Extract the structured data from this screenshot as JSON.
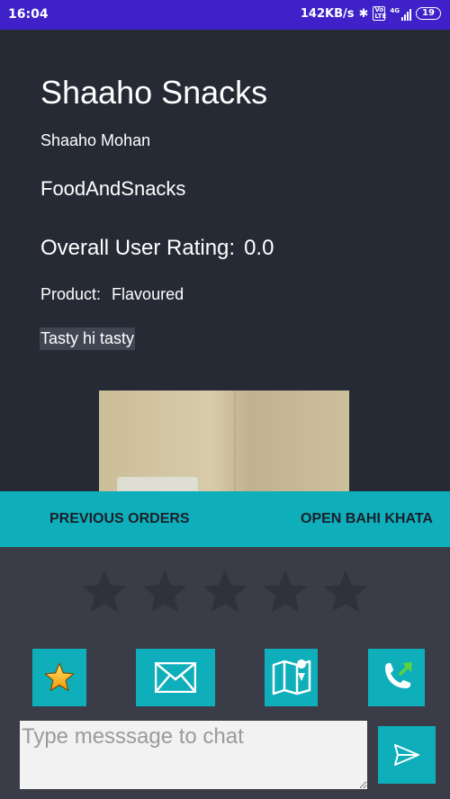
{
  "status_bar": {
    "time": "16:04",
    "network_speed": "142KB/s",
    "volte_label": "Vo LTE",
    "network_type": "4G",
    "battery_level": "19",
    "bluetooth_icon": "bluetooth-icon",
    "signal_icon": "signal-icon"
  },
  "store": {
    "name": "Shaaho Snacks",
    "owner": "Shaaho Mohan",
    "category": "FoodAndSnacks",
    "rating_label": "Overall User Rating:",
    "rating_value": "0.0",
    "product_label": "Product:",
    "product_value": "Flavoured",
    "description": "Tasty hi tasty"
  },
  "actions": {
    "previous_orders": "PREVIOUS ORDERS",
    "open_bahi_khata": "OPEN BAHI KHATA"
  },
  "rating_input": {
    "max_stars": 5,
    "selected": 0,
    "empty_color": "#2f323c"
  },
  "icons": {
    "favorite": "star-icon",
    "mail": "mail-icon",
    "map": "map-icon",
    "call": "call-icon",
    "send": "send-icon"
  },
  "chat": {
    "value": "",
    "placeholder": "Type messsage to chat"
  },
  "colors": {
    "status_bar": "#3e21c8",
    "background": "#262a35",
    "accent": "#0eafbb",
    "lower_panel": "#3a3d48"
  }
}
